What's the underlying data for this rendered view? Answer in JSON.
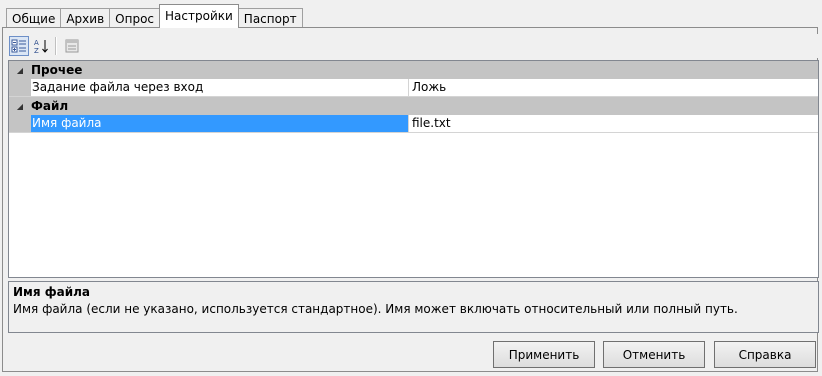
{
  "tabs": [
    {
      "label": "Общие",
      "active": false
    },
    {
      "label": "Архив",
      "active": false
    },
    {
      "label": "Опрос",
      "active": false
    },
    {
      "label": "Настройки",
      "active": true
    },
    {
      "label": "Паспорт",
      "active": false
    }
  ],
  "grid": {
    "categories": [
      {
        "name": "Прочее",
        "properties": [
          {
            "name": "Задание файла через вход",
            "value": "Ложь",
            "selected": false
          }
        ]
      },
      {
        "name": "Файл",
        "properties": [
          {
            "name": "Имя файла",
            "value": "file.txt",
            "selected": true
          }
        ]
      }
    ]
  },
  "help": {
    "title": "Имя файла",
    "description": "Имя файла (если не указано, используется стандартное). Имя может включать относительный или полный путь."
  },
  "buttons": {
    "apply": "Применить",
    "cancel": "Отменить",
    "help": "Справка"
  },
  "colors": {
    "selection": "#3399ff",
    "category_band": "#c4c4c4"
  }
}
